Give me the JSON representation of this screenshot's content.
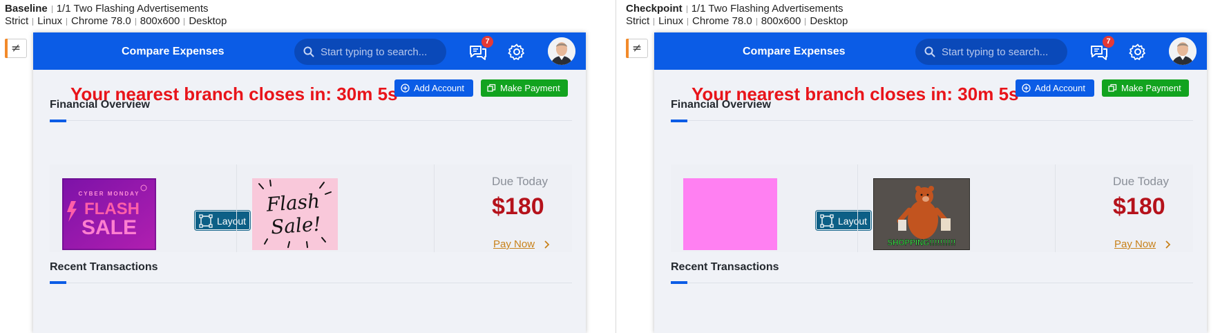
{
  "panels": [
    {
      "heading": {
        "name": "Baseline",
        "test": "1/1 Two Flashing Advertisements"
      },
      "meta": [
        "Strict",
        "Linux",
        "Chrome 78.0",
        "800x600",
        "Desktop"
      ],
      "diff_icon": "≠",
      "app": {
        "brand": "Compare Expenses",
        "search_placeholder": "Start typing to search...",
        "notification_count": "7",
        "countdown": "Your nearest branch closes in: 30m 5s",
        "add_account": "Add Account",
        "make_payment": "Make Payment",
        "financial_overview": "Financial Overview",
        "layout_tag": "Layout",
        "due_label": "Due Today",
        "due_amount": "$180",
        "pay_now": "Pay Now",
        "recent_transactions": "Recent Transactions",
        "ad1": {
          "type": "cyber-monday-flash-sale",
          "top_text": "CYBER MONDAY",
          "line1": "FLASH",
          "line2": "SALE"
        },
        "ad2": {
          "type": "flash-sale-lettering",
          "line1": "Flash",
          "line2": "Sale!"
        }
      }
    },
    {
      "heading": {
        "name": "Checkpoint",
        "test": "1/1 Two Flashing Advertisements"
      },
      "meta": [
        "Strict",
        "Linux",
        "Chrome 78.0",
        "800x600",
        "Desktop"
      ],
      "diff_icon": "≠",
      "app": {
        "brand": "Compare Expenses",
        "search_placeholder": "Start typing to search...",
        "notification_count": "7",
        "countdown": "Your nearest branch closes in: 30m 5s",
        "add_account": "Add Account",
        "make_payment": "Make Payment",
        "financial_overview": "Financial Overview",
        "layout_tag": "Layout",
        "due_label": "Due Today",
        "due_amount": "$180",
        "pay_now": "Pay Now",
        "recent_transactions": "Recent Transactions",
        "ad1": {
          "type": "solid-pink-placeholder"
        },
        "ad2": {
          "type": "bear-shopping-gif",
          "caption": "SHOPPING!!!!!!!!!!"
        }
      }
    }
  ],
  "colors": {
    "topbar": "#0b5ce6",
    "countdown": "#e8141a",
    "add_account": "#0b5ce6",
    "make_payment": "#12a31f",
    "due_amount": "#b5121b",
    "pay_now": "#c8811a",
    "diff_marker": "#f28a2a"
  }
}
